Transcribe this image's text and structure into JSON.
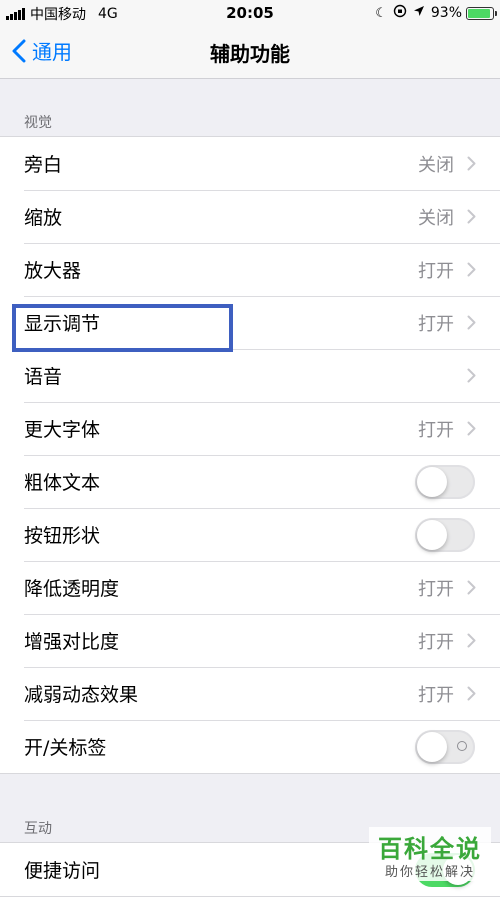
{
  "status_bar": {
    "carrier": "中国移动",
    "network": "4G",
    "time": "20:05",
    "battery_percent": "93%",
    "battery_level": 0.93,
    "battery_color": "#4cd964"
  },
  "nav": {
    "back_label": "通用",
    "title": "辅助功能",
    "accent_color": "#007aff"
  },
  "vision_section": {
    "header": "视觉",
    "rows": [
      {
        "label": "旁白",
        "value": "关闭",
        "type": "disclosure"
      },
      {
        "label": "缩放",
        "value": "关闭",
        "type": "disclosure"
      },
      {
        "label": "放大器",
        "value": "打开",
        "type": "disclosure"
      },
      {
        "label": "显示调节",
        "value": "打开",
        "type": "disclosure"
      },
      {
        "label": "语音",
        "value": "",
        "type": "disclosure"
      },
      {
        "label": "更大字体",
        "value": "打开",
        "type": "disclosure"
      },
      {
        "label": "粗体文本",
        "type": "toggle",
        "on": false
      },
      {
        "label": "按钮形状",
        "type": "toggle",
        "on": false
      },
      {
        "label": "降低透明度",
        "value": "打开",
        "type": "disclosure"
      },
      {
        "label": "增强对比度",
        "value": "打开",
        "type": "disclosure"
      },
      {
        "label": "减弱动态效果",
        "value": "打开",
        "type": "disclosure"
      },
      {
        "label": "开/关标签",
        "type": "toggle",
        "on": false
      }
    ]
  },
  "interaction_section": {
    "header": "互动",
    "rows": [
      {
        "label": "便捷访问",
        "type": "toggle",
        "on": true
      }
    ]
  },
  "watermark": {
    "title": "百科全说",
    "subtitle": "助你轻松解决"
  },
  "highlight_color": "#3e5fc0"
}
